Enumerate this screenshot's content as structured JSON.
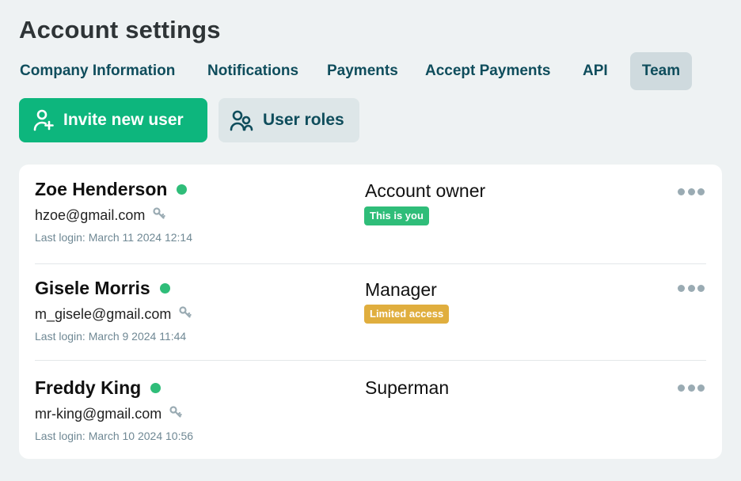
{
  "header": {
    "title": "Account settings"
  },
  "tabs": [
    {
      "label": "Company Information"
    },
    {
      "label": "Notifications"
    },
    {
      "label": "Payments"
    },
    {
      "label": "Accept Payments"
    },
    {
      "label": "API"
    },
    {
      "label": "Team",
      "active": true
    }
  ],
  "actions": {
    "invite_label": "Invite new user",
    "invite_icon": "add-user-icon",
    "roles_label": "User roles",
    "roles_icon": "users-icon"
  },
  "users": [
    {
      "name": "Zoe Henderson",
      "email": "hzoe@gmail.com",
      "last_login": "Last login: March 11 2024 12:14",
      "role": "Account owner",
      "badge": "This is you",
      "online": true
    },
    {
      "name": "Gisele Morris",
      "email": "m_gisele@gmail.com",
      "last_login": "Last login: March 9 2024 11:44",
      "role": "Manager",
      "badge": "Limited access",
      "online": true
    },
    {
      "name": "Freddy King",
      "email": "mr-king@gmail.com",
      "last_login": "Last login: March 10 2024 10:56",
      "role": "Superman",
      "badge": "",
      "online": true
    }
  ],
  "colors": {
    "accent": "#0db67d",
    "tab_text": "#0f4d5c",
    "online": "#2fbd79",
    "badge_you": "#2fbd79",
    "badge_limited": "#e0ae3e",
    "background": "#eef2f3"
  }
}
